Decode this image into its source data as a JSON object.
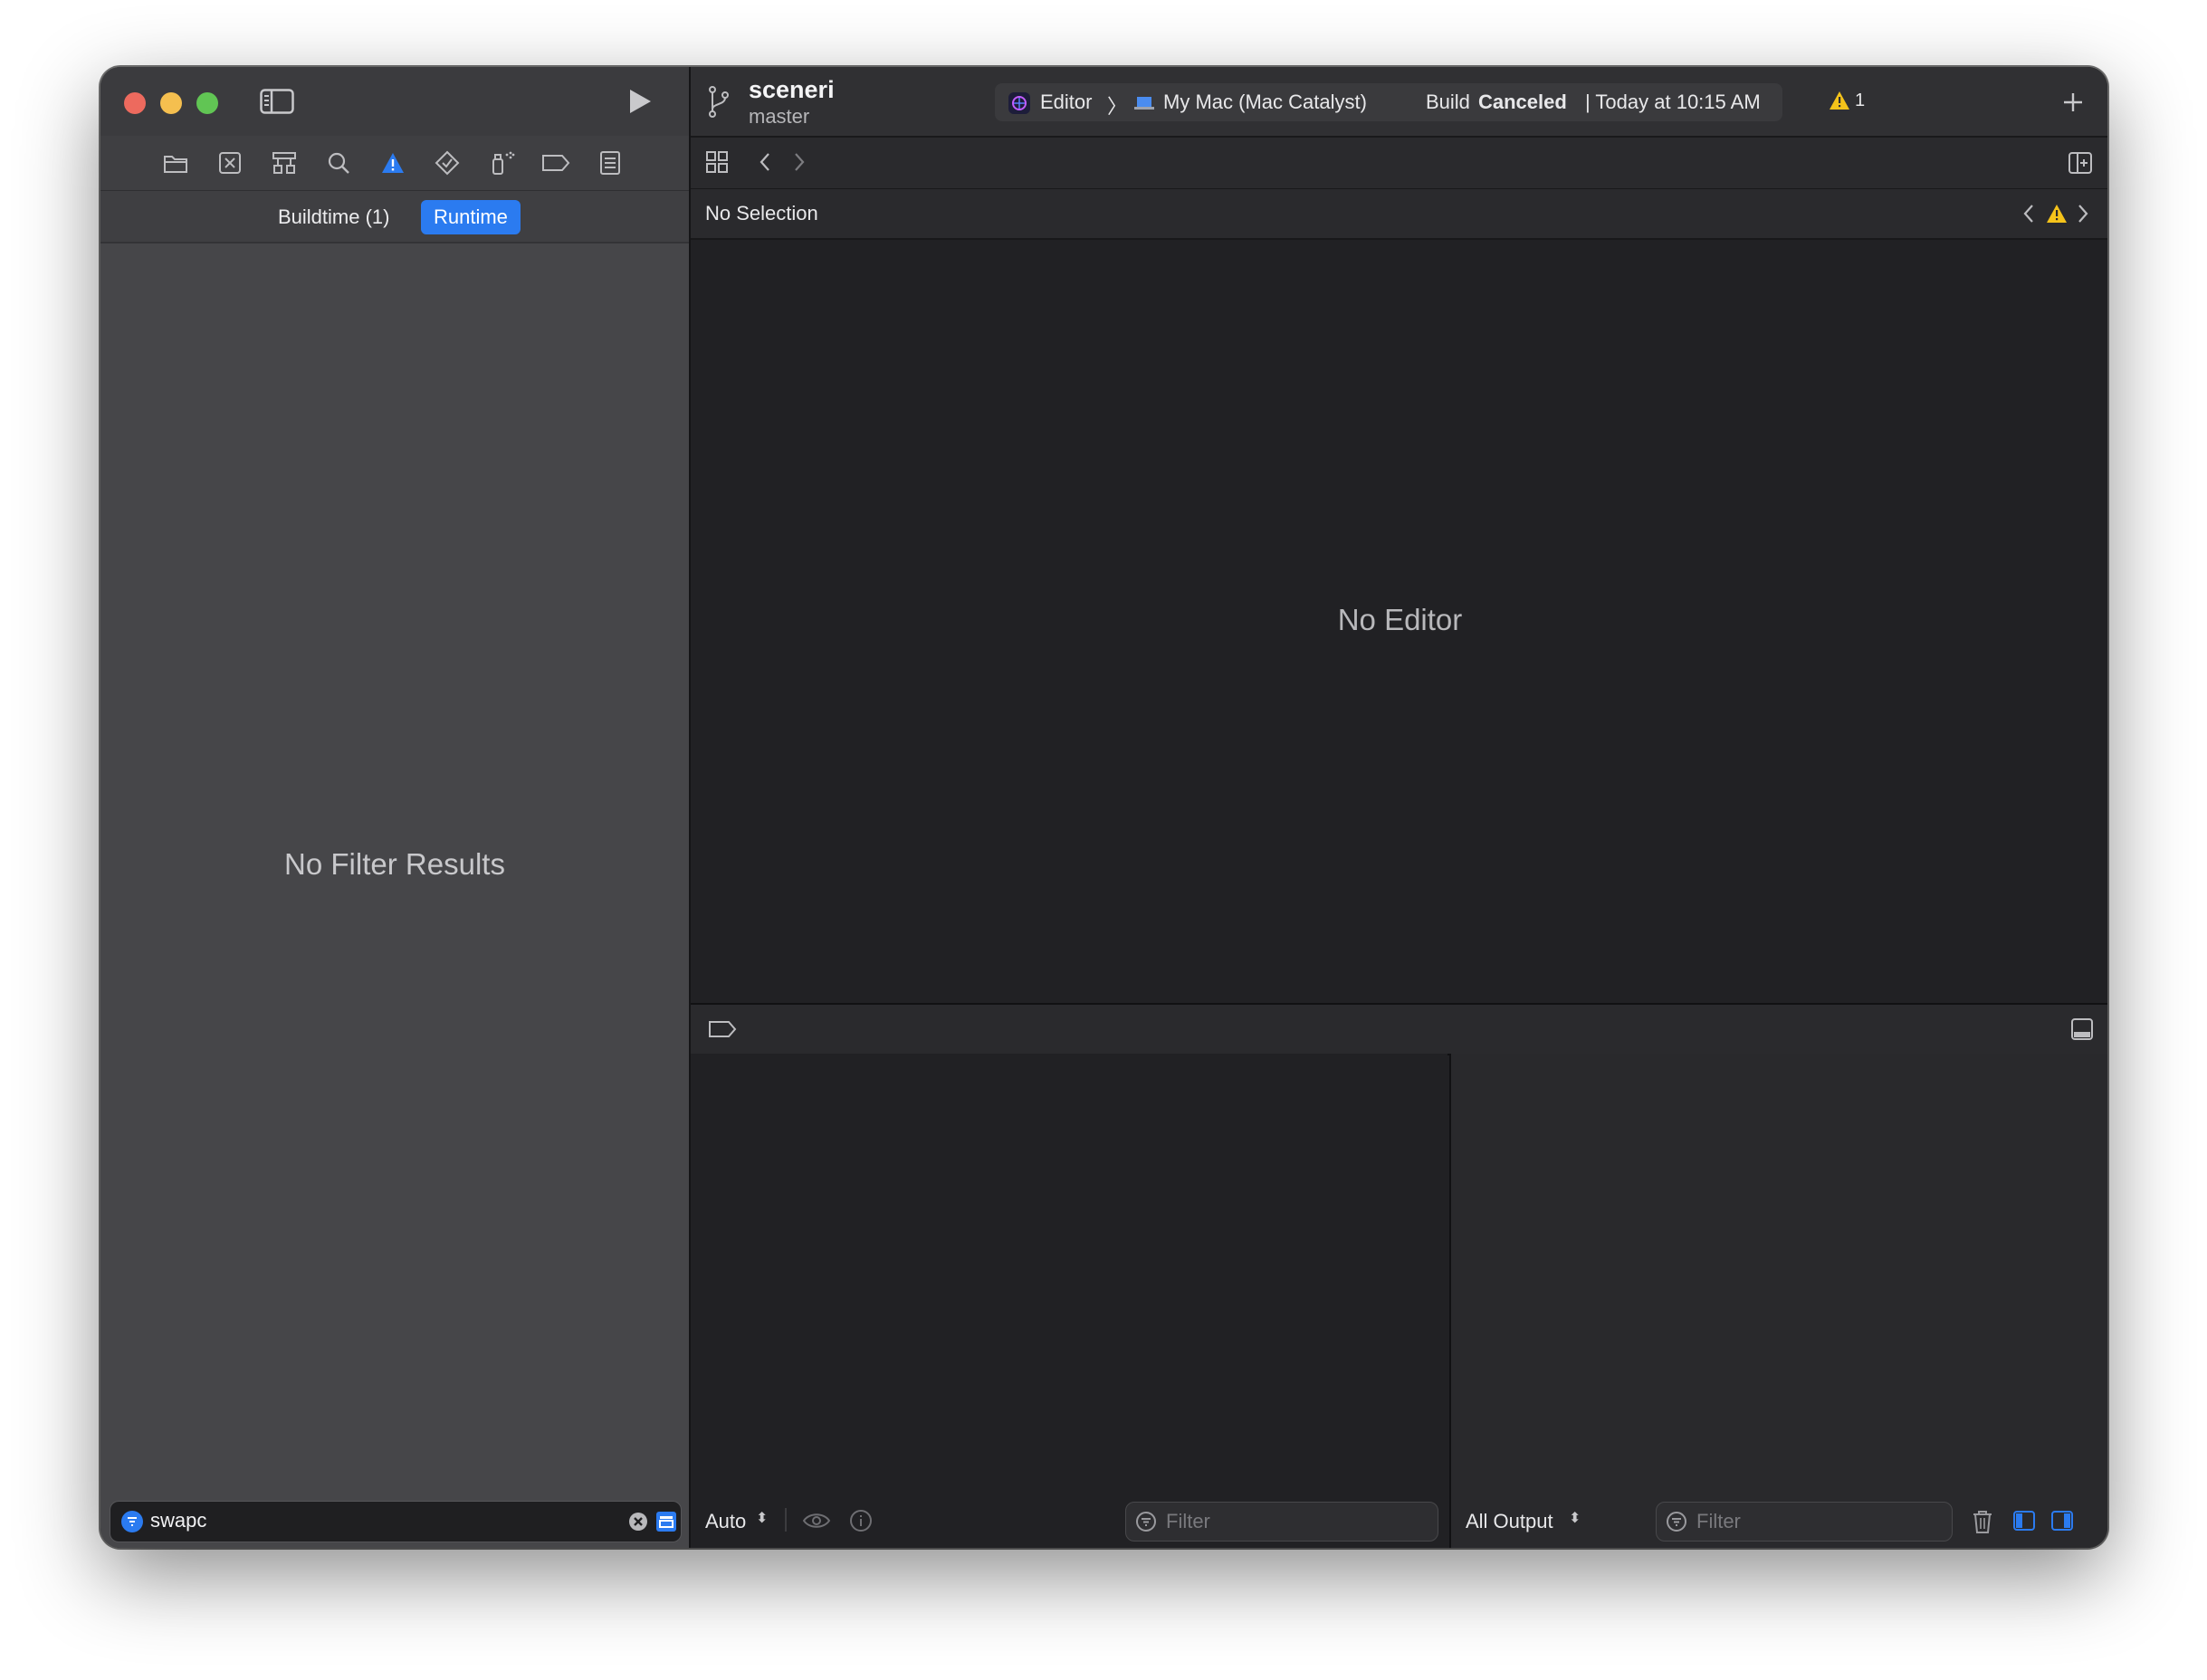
{
  "window": {
    "project_name": "sceneri",
    "branch": "master"
  },
  "toolbar": {
    "scheme": "Editor",
    "destination": "My Mac (Mac Catalyst)",
    "status_prefix": "Build",
    "status_bold": "Canceled",
    "status_suffix": "| Today at 10:15 AM",
    "warning_count": "1"
  },
  "navigator": {
    "tabs": [
      {
        "label": "Buildtime (1)",
        "active": false
      },
      {
        "label": "Runtime",
        "active": true
      }
    ],
    "empty_message": "No Filter Results",
    "filter_value": "swapc"
  },
  "editor": {
    "path_label": "No Selection",
    "empty_message": "No Editor"
  },
  "debug_area": {
    "variables_scope": "Auto",
    "variables_filter_placeholder": "Filter",
    "console_output": "All Output",
    "console_filter_placeholder": "Filter"
  },
  "colors": {
    "accent": "#2b7bf0",
    "warning": "#f5c31a",
    "close": "#ed6a5e",
    "minimize": "#f5bf4f",
    "zoom": "#61c554"
  }
}
